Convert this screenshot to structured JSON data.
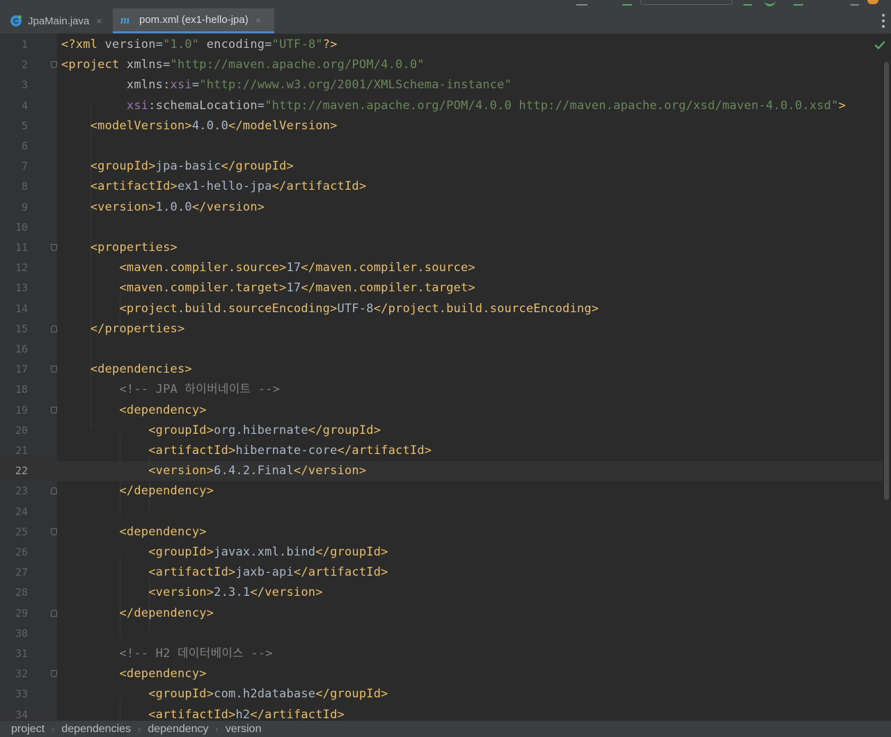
{
  "tabs": [
    {
      "label": "JpaMain.java",
      "icon": "java-class-icon",
      "active": false
    },
    {
      "label": "pom.xml (ex1-hello-jpa)",
      "icon": "maven-m-icon",
      "active": true
    }
  ],
  "close_glyph": "×",
  "editor": {
    "current_line": 22,
    "lines": [
      {
        "n": "1",
        "tokens": [
          [
            "t",
            "<?"
          ],
          [
            "t",
            "xml "
          ],
          [
            "a",
            "version"
          ],
          [
            "x",
            "="
          ],
          [
            "v",
            "\"1.0\""
          ],
          [
            "x",
            " "
          ],
          [
            "a",
            "encoding"
          ],
          [
            "x",
            "="
          ],
          [
            "v",
            "\"UTF-8\""
          ],
          [
            "t",
            "?>"
          ]
        ]
      },
      {
        "n": "2",
        "tokens": [
          [
            "t",
            "<project "
          ],
          [
            "a",
            "xmlns"
          ],
          [
            "x",
            "="
          ],
          [
            "v",
            "\"http://maven.apache.org/POM/4.0.0\""
          ]
        ]
      },
      {
        "n": "3",
        "tokens": [
          [
            "x",
            "         "
          ],
          [
            "a",
            "xmlns"
          ],
          [
            "x",
            ":"
          ],
          [
            "n",
            "xsi"
          ],
          [
            "x",
            "="
          ],
          [
            "v",
            "\"http://www.w3.org/2001/XMLSchema-instance\""
          ]
        ]
      },
      {
        "n": "4",
        "tokens": [
          [
            "x",
            "         "
          ],
          [
            "n",
            "xsi"
          ],
          [
            "x",
            ":"
          ],
          [
            "a",
            "schemaLocation"
          ],
          [
            "x",
            "="
          ],
          [
            "v",
            "\"http://maven.apache.org/POM/4.0.0 http://maven.apache.org/xsd/maven-4.0.0.xsd\""
          ],
          [
            "t",
            ">"
          ]
        ]
      },
      {
        "n": "5",
        "tokens": [
          [
            "x",
            "    "
          ],
          [
            "t",
            "<modelVersion>"
          ],
          [
            "x",
            "4.0.0"
          ],
          [
            "t",
            "</modelVersion>"
          ]
        ]
      },
      {
        "n": "6",
        "tokens": []
      },
      {
        "n": "7",
        "tokens": [
          [
            "x",
            "    "
          ],
          [
            "t",
            "<groupId>"
          ],
          [
            "x",
            "jpa-basic"
          ],
          [
            "t",
            "</groupId>"
          ]
        ]
      },
      {
        "n": "8",
        "tokens": [
          [
            "x",
            "    "
          ],
          [
            "t",
            "<artifactId>"
          ],
          [
            "x",
            "ex1-hello-jpa"
          ],
          [
            "t",
            "</artifactId>"
          ]
        ]
      },
      {
        "n": "9",
        "tokens": [
          [
            "x",
            "    "
          ],
          [
            "t",
            "<version>"
          ],
          [
            "x",
            "1.0.0"
          ],
          [
            "t",
            "</version>"
          ]
        ]
      },
      {
        "n": "10",
        "tokens": []
      },
      {
        "n": "11",
        "tokens": [
          [
            "x",
            "    "
          ],
          [
            "t",
            "<properties>"
          ]
        ]
      },
      {
        "n": "12",
        "tokens": [
          [
            "x",
            "        "
          ],
          [
            "t",
            "<maven.compiler.source>"
          ],
          [
            "x",
            "17"
          ],
          [
            "t",
            "</maven.compiler.source>"
          ]
        ]
      },
      {
        "n": "13",
        "tokens": [
          [
            "x",
            "        "
          ],
          [
            "t",
            "<maven.compiler.target>"
          ],
          [
            "x",
            "17"
          ],
          [
            "t",
            "</maven.compiler.target>"
          ]
        ]
      },
      {
        "n": "14",
        "tokens": [
          [
            "x",
            "        "
          ],
          [
            "t",
            "<project.build.sourceEncoding>"
          ],
          [
            "x",
            "UTF-8"
          ],
          [
            "t",
            "</project.build.sourceEncoding>"
          ]
        ]
      },
      {
        "n": "15",
        "tokens": [
          [
            "x",
            "    "
          ],
          [
            "t",
            "</properties>"
          ]
        ]
      },
      {
        "n": "16",
        "tokens": []
      },
      {
        "n": "17",
        "tokens": [
          [
            "x",
            "    "
          ],
          [
            "t",
            "<dependencies>"
          ]
        ]
      },
      {
        "n": "18",
        "tokens": [
          [
            "x",
            "        "
          ],
          [
            "c",
            "<!-- JPA 하이버네이트 -->"
          ]
        ]
      },
      {
        "n": "19",
        "tokens": [
          [
            "x",
            "        "
          ],
          [
            "t",
            "<dependency>"
          ]
        ]
      },
      {
        "n": "20",
        "tokens": [
          [
            "x",
            "            "
          ],
          [
            "t",
            "<groupId>"
          ],
          [
            "x",
            "org.hibernate"
          ],
          [
            "t",
            "</groupId>"
          ]
        ]
      },
      {
        "n": "21",
        "tokens": [
          [
            "x",
            "            "
          ],
          [
            "t",
            "<artifactId>"
          ],
          [
            "x",
            "hibernate-core"
          ],
          [
            "t",
            "</artifactId>"
          ]
        ]
      },
      {
        "n": "22",
        "tokens": [
          [
            "x",
            "            "
          ],
          [
            "t",
            "<version>"
          ],
          [
            "x",
            "6.4.2.Final"
          ],
          [
            "t",
            "</version>"
          ]
        ]
      },
      {
        "n": "23",
        "tokens": [
          [
            "x",
            "        "
          ],
          [
            "t",
            "</dependency>"
          ]
        ]
      },
      {
        "n": "24",
        "tokens": []
      },
      {
        "n": "25",
        "tokens": [
          [
            "x",
            "        "
          ],
          [
            "t",
            "<dependency>"
          ]
        ]
      },
      {
        "n": "26",
        "tokens": [
          [
            "x",
            "            "
          ],
          [
            "t",
            "<groupId>"
          ],
          [
            "x",
            "javax.xml.bind"
          ],
          [
            "t",
            "</groupId>"
          ]
        ]
      },
      {
        "n": "27",
        "tokens": [
          [
            "x",
            "            "
          ],
          [
            "t",
            "<artifactId>"
          ],
          [
            "x",
            "jaxb-api"
          ],
          [
            "t",
            "</artifactId>"
          ]
        ]
      },
      {
        "n": "28",
        "tokens": [
          [
            "x",
            "            "
          ],
          [
            "t",
            "<version>"
          ],
          [
            "x",
            "2.3.1"
          ],
          [
            "t",
            "</version>"
          ]
        ]
      },
      {
        "n": "29",
        "tokens": [
          [
            "x",
            "        "
          ],
          [
            "t",
            "</dependency>"
          ]
        ]
      },
      {
        "n": "30",
        "tokens": []
      },
      {
        "n": "31",
        "tokens": [
          [
            "x",
            "        "
          ],
          [
            "c",
            "<!-- H2 데이터베이스 -->"
          ]
        ]
      },
      {
        "n": "32",
        "tokens": [
          [
            "x",
            "        "
          ],
          [
            "t",
            "<dependency>"
          ]
        ]
      },
      {
        "n": "33",
        "tokens": [
          [
            "x",
            "            "
          ],
          [
            "t",
            "<groupId>"
          ],
          [
            "x",
            "com.h2database"
          ],
          [
            "t",
            "</groupId>"
          ]
        ]
      },
      {
        "n": "34",
        "tokens": [
          [
            "x",
            "            "
          ],
          [
            "t",
            "<artifactId>"
          ],
          [
            "x",
            "h2"
          ],
          [
            "t",
            "</artifactId>"
          ]
        ]
      }
    ],
    "fold_markers": {
      "2": "open",
      "11": "open",
      "15": "close",
      "17": "open",
      "19": "open",
      "23": "close",
      "25": "open",
      "29": "close",
      "32": "open"
    }
  },
  "breadcrumb": [
    "project",
    "dependencies",
    "dependency",
    "version"
  ],
  "breadcrumb_separator": "›",
  "colors": {
    "tag": "#e8bf6a",
    "attribute": "#bababa",
    "value": "#6a8759",
    "namespace": "#9876aa",
    "comment": "#808080",
    "text": "#a9b7c6",
    "background": "#2b2b2b",
    "inspection_ok": "#59a869"
  }
}
